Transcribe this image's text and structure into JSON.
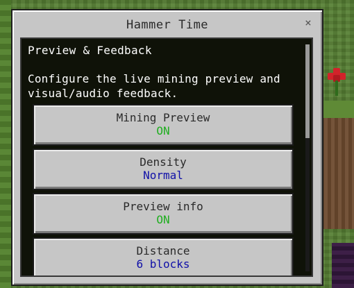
{
  "dialog": {
    "title": "Hammer Time",
    "close_symbol": "×",
    "section_title": "Preview & Feedback",
    "description": "Configure the live mining preview and visual/audio feedback."
  },
  "options": [
    {
      "label": "Mining Preview",
      "value": "ON",
      "value_color": "#1fae1f"
    },
    {
      "label": "Density",
      "value": "Normal",
      "value_color": "#1010a8"
    },
    {
      "label": "Preview info",
      "value": "ON",
      "value_color": "#1fae1f"
    },
    {
      "label": "Distance",
      "value": "6 blocks",
      "value_color": "#1010a8"
    }
  ],
  "colors": {
    "panel": "#c6c6c6",
    "content_bg": "#0f1208",
    "on": "#1fae1f",
    "enum": "#1010a8"
  }
}
